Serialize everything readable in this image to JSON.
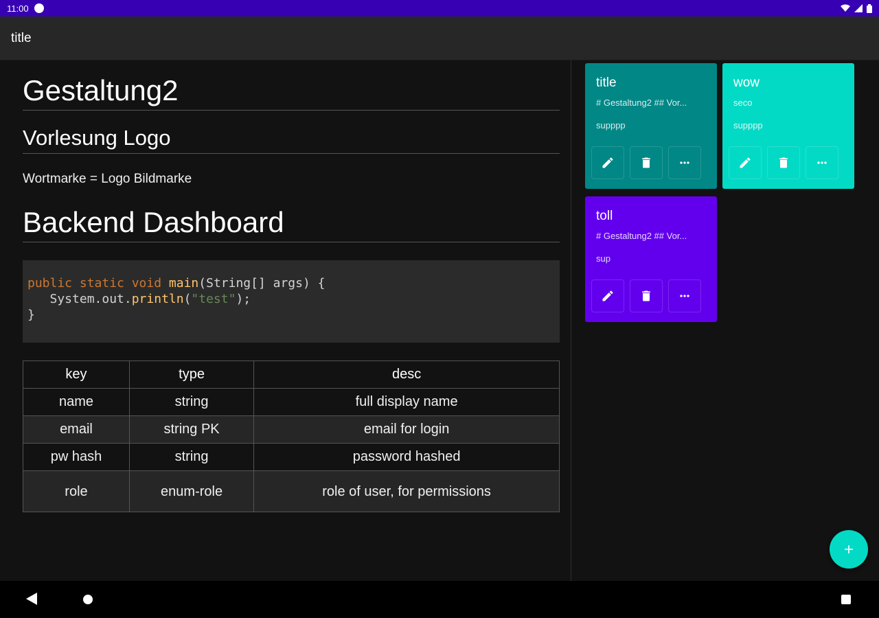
{
  "status_bar": {
    "time": "11:00"
  },
  "app_bar": {
    "title": "title"
  },
  "document": {
    "h1": "Gestaltung2",
    "h2": "Vorlesung Logo",
    "paragraph": "Wortmarke = Logo Bildmarke",
    "h1b": "Backend Dashboard",
    "code": {
      "line1_kw": "public static void ",
      "line1_fn": "main",
      "line1_rest": "(String[] args) {",
      "line2_pre": "   System.out.",
      "line2_fn": "println",
      "line2_open": "(",
      "line2_str": "\"test\"",
      "line2_close": ");",
      "line3": "}"
    },
    "table": {
      "headers": [
        "key",
        "type",
        "desc"
      ],
      "rows": [
        [
          "name",
          "string",
          "full display name"
        ],
        [
          "email",
          "string PK",
          "email for login"
        ],
        [
          "pw hash",
          "string",
          "password hashed"
        ],
        [
          "role",
          "enum-role",
          "role of user, for permissions"
        ]
      ]
    }
  },
  "cards": [
    {
      "title": "title",
      "preview": "# Gestaltung2 ## Vor...",
      "subtitle": "supppp",
      "color": "#018786"
    },
    {
      "title": "wow",
      "preview": "seco",
      "subtitle": "supppp",
      "color": "#03dac5"
    },
    {
      "title": "toll",
      "preview": "# Gestaltung2 ## Vor...",
      "subtitle": "sup",
      "color": "#6200ee"
    }
  ],
  "icons": {
    "edit": "pencil-icon",
    "delete": "trash-icon",
    "more": "more-horizontal-icon",
    "fab": "plus-icon"
  },
  "colors": {
    "status_bar": "#3700b3",
    "fab": "#03dac5",
    "background": "#121212"
  }
}
